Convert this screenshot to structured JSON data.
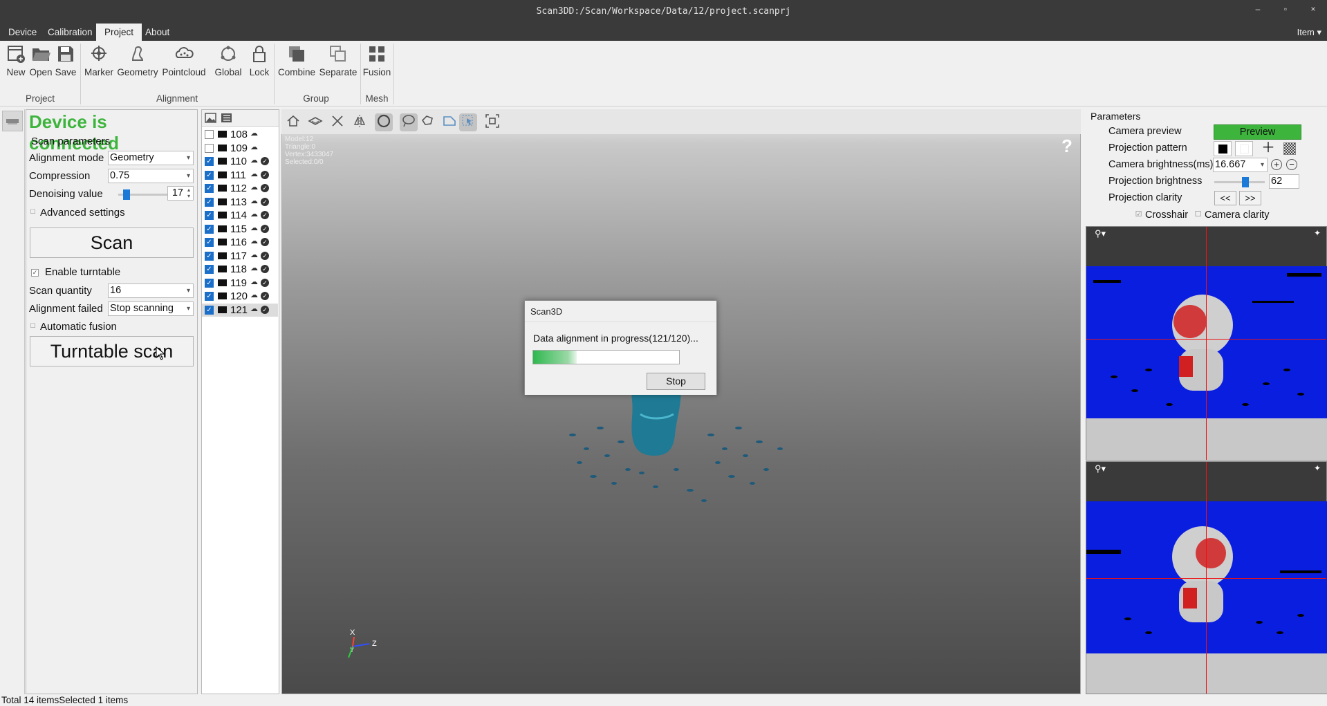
{
  "window": {
    "title": "Scan3DD:/Scan/Workspace/Data/12/project.scanprj",
    "minimize": "–",
    "maximize": "▫",
    "close": "×"
  },
  "menu": {
    "items": [
      "Device",
      "Calibration",
      "Project",
      "About"
    ],
    "active": "Project",
    "right": "Item ▾"
  },
  "ribbon": {
    "tools": {
      "new": "New",
      "open": "Open",
      "save": "Save",
      "marker": "Marker",
      "geometry": "Geometry",
      "pointcloud": "Pointcloud",
      "global": "Global",
      "lock": "Lock",
      "combine": "Combine",
      "separate": "Separate",
      "fusion": "Fusion"
    },
    "groups": {
      "project": "Project",
      "alignment": "Alignment",
      "group": "Group",
      "mesh": "Mesh"
    }
  },
  "left_panel": {
    "status": "Device is connected",
    "status_color": "#3db53d",
    "scan_parameters": "Scan parameters",
    "alignment_mode_label": "Alignment mode",
    "alignment_mode_value": "Geometry",
    "compression_label": "Compression",
    "compression_value": "0.75",
    "denoising_label": "Denoising value",
    "denoising_value": "17",
    "advanced_settings": "Advanced settings",
    "scan_button": "Scan",
    "enable_turntable": "Enable turntable",
    "enable_turntable_checked": true,
    "scan_quantity_label": "Scan quantity",
    "scan_quantity_value": "16",
    "alignment_failed_label": "Alignment failed",
    "alignment_failed_value": "Stop scanning",
    "automatic_fusion": "Automatic fusion",
    "turntable_scan_button": "Turntable scan"
  },
  "scan_list": [
    {
      "id": "108",
      "checked": false,
      "aligned": false
    },
    {
      "id": "109",
      "checked": false,
      "aligned": false
    },
    {
      "id": "110",
      "checked": true,
      "aligned": true
    },
    {
      "id": "111",
      "checked": true,
      "aligned": true
    },
    {
      "id": "112",
      "checked": true,
      "aligned": true
    },
    {
      "id": "113",
      "checked": true,
      "aligned": true
    },
    {
      "id": "114",
      "checked": true,
      "aligned": true
    },
    {
      "id": "115",
      "checked": true,
      "aligned": true
    },
    {
      "id": "116",
      "checked": true,
      "aligned": true
    },
    {
      "id": "117",
      "checked": true,
      "aligned": true
    },
    {
      "id": "118",
      "checked": true,
      "aligned": true
    },
    {
      "id": "119",
      "checked": true,
      "aligned": true
    },
    {
      "id": "120",
      "checked": true,
      "aligned": true
    },
    {
      "id": "121",
      "checked": true,
      "aligned": true,
      "selected": true
    }
  ],
  "viewport": {
    "stats": [
      "Model:12",
      "Triangle:0",
      "Vertex:3433047",
      "Selected:0/0"
    ],
    "help": "?",
    "axis_x": "X",
    "axis_y": "Y",
    "axis_z": "Z"
  },
  "dialog": {
    "title": "Scan3D",
    "message": "Data alignment in progress(121/120)...",
    "progress": 0.3,
    "stop": "Stop"
  },
  "right_panel": {
    "title": "Parameters",
    "camera_preview_label": "Camera preview",
    "preview_button": "Preview",
    "preview_color": "#3db53d",
    "projection_pattern_label": "Projection pattern",
    "camera_brightness_label": "Camera brightness(ms)",
    "camera_brightness_value": "16.667",
    "projection_brightness_label": "Projection brightness",
    "projection_brightness_value": "62",
    "projection_clarity_label": "Projection clarity",
    "clarity_prev": "<<",
    "clarity_next": ">>",
    "crosshair": "Crosshair",
    "crosshair_checked": true,
    "camera_clarity": "Camera clarity",
    "camera_clarity_checked": false
  },
  "status_bar": "Total 14 itemsSelected 1 items"
}
